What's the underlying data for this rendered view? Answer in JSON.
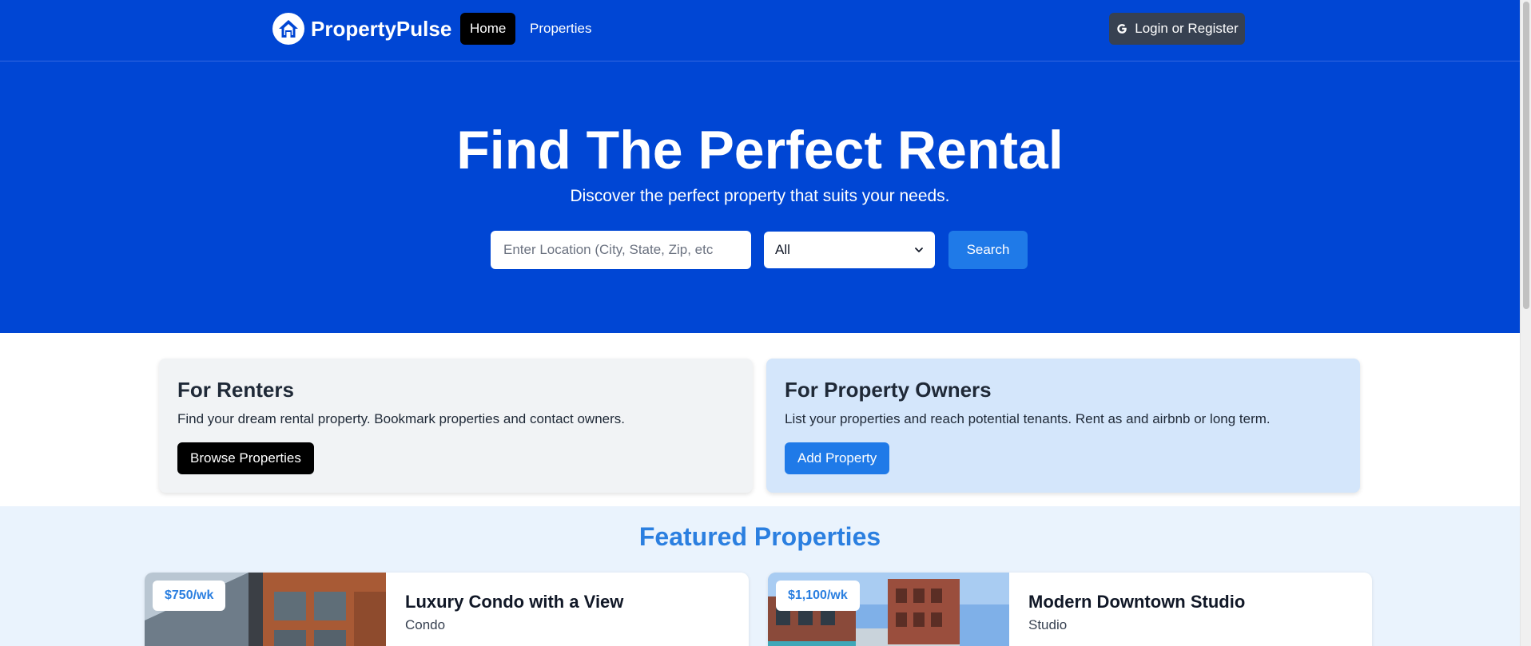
{
  "brand": {
    "name": "PropertyPulse"
  },
  "nav": {
    "links": [
      {
        "label": "Home",
        "active": true
      },
      {
        "label": "Properties",
        "active": false
      }
    ],
    "login_label": "Login or Register"
  },
  "hero": {
    "title": "Find The Perfect Rental",
    "subtitle": "Discover the perfect property that suits your needs.",
    "search": {
      "placeholder": "Enter Location (City, State, Zip, etc",
      "value": "",
      "type_selected": "All",
      "button_label": "Search"
    }
  },
  "info": {
    "renters": {
      "title": "For Renters",
      "description": "Find your dream rental property. Bookmark properties and contact owners.",
      "button_label": "Browse Properties"
    },
    "owners": {
      "title": "For Property Owners",
      "description": "List your properties and reach potential tenants. Rent as and airbnb or long term.",
      "button_label": "Add Property"
    }
  },
  "featured": {
    "title": "Featured Properties",
    "cards": [
      {
        "price": "$750/wk",
        "title": "Luxury Condo with a View",
        "type": "Condo"
      },
      {
        "price": "$1,100/wk",
        "title": "Modern Downtown Studio",
        "type": "Studio"
      }
    ]
  },
  "colors": {
    "brand_blue": "#0046d4",
    "accent_blue": "#1f7ae8",
    "featured_text": "#2b7fe0",
    "renters_bg": "#f1f3f5",
    "owners_bg": "#d4e6fb",
    "featured_bg": "#eaf3fd"
  },
  "icons": {
    "logo": "house-logo-icon",
    "login": "google-icon",
    "select": "chevron-down-icon"
  }
}
